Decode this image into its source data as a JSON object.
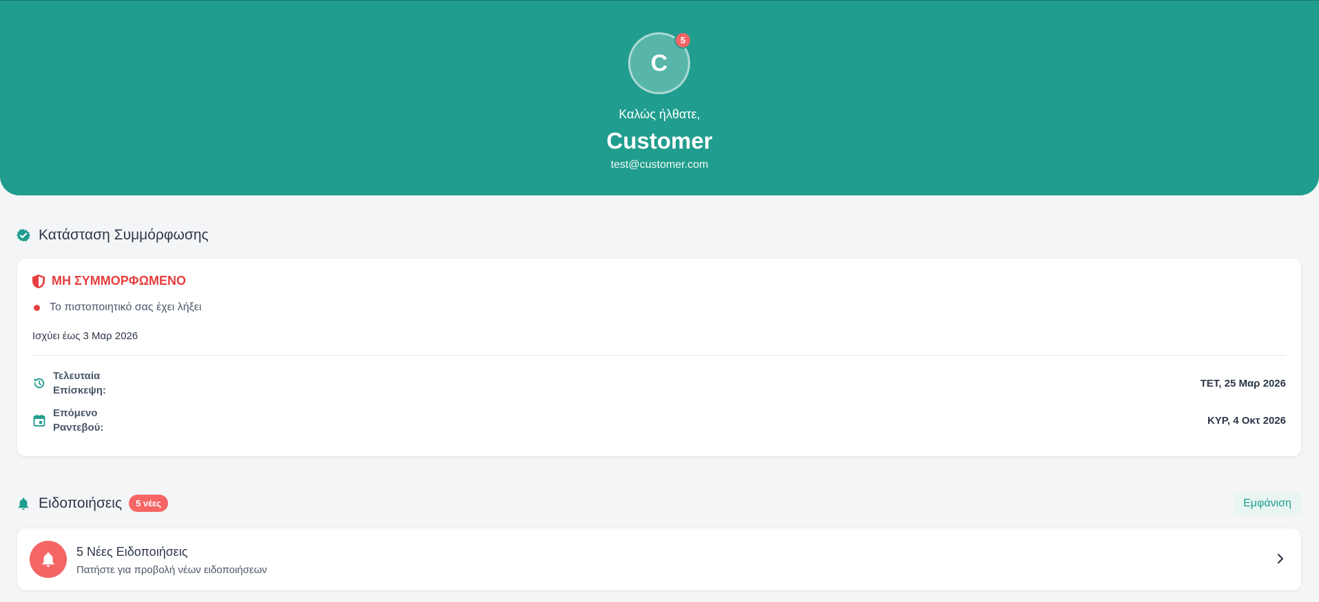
{
  "header": {
    "avatar_initial": "C",
    "notification_count": "5",
    "welcome": "Καλώς ήλθατε,",
    "name": "Customer",
    "email": "test@customer.com",
    "color": "#209d8e"
  },
  "compliance": {
    "title": "Κατάσταση Συμμόρφωσης",
    "status": "ΜΗ ΣΥΜΜΟΡΦΩΜΕΝΟ",
    "status_color": "#e53e3e",
    "note": "Το πιστοποιητικό σας έχει λήξει",
    "valid_until": "Ισχύει έως 3 Μαρ 2026",
    "last_visit_label": "Τελευταία Επίσκεψη:",
    "last_visit_value": "ΤΕΤ, 25 Μαρ 2026",
    "next_appointment_label": "Επόμενο Ραντεβού:",
    "next_appointment_value": "ΚΥΡ, 4 Οκτ 2026"
  },
  "notifications": {
    "title": "Ειδοποιήσεις",
    "badge": "5 νέες",
    "show_button": "Εμφάνιση",
    "item_title": "5 Νέες Ειδοποιήσεις",
    "item_subtitle": "Πατήστε για προβολή νέων ειδοποιήσεων"
  },
  "icons": {
    "compliance": "verified-badge-icon",
    "status": "shield-icon",
    "last_visit": "history-icon",
    "next_appointment": "calendar-icon",
    "notifications": "bell-icon",
    "chevron": "chevron-right-icon"
  }
}
